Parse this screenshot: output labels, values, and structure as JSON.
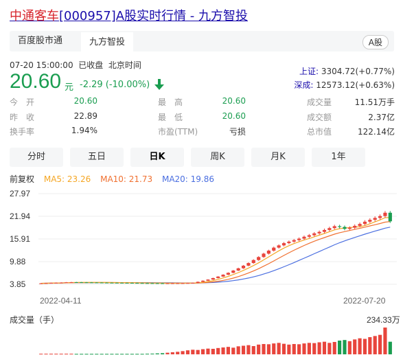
{
  "title": {
    "stock_name": "中通客车",
    "code_suffix": "[000957]A股实时行情 - 九方智投"
  },
  "tabs": [
    {
      "label": "百度股市通"
    },
    {
      "label": "九方智投"
    }
  ],
  "market_badge": "A股",
  "status": {
    "time": "07-20 15:00:00",
    "state": "已收盘",
    "zone": "北京时间"
  },
  "price": {
    "value": "20.60",
    "unit": "元",
    "change": "-2.29 (-10.00%)"
  },
  "indices": [
    {
      "name": "上证:",
      "value": "3304.72(+0.77%)"
    },
    {
      "name": "深成:",
      "value": "12573.12(+0.63%)"
    }
  ],
  "stats": [
    [
      {
        "label": "今　开",
        "value": "20.60",
        "green": true
      },
      {
        "label": "最　高",
        "value": "20.60",
        "green": true
      },
      {
        "label": "成交量",
        "value": "11.51万手"
      }
    ],
    [
      {
        "label": "昨　收",
        "value": "22.89"
      },
      {
        "label": "最　低",
        "value": "20.60",
        "green": true
      },
      {
        "label": "成交额",
        "value": "2.37亿"
      }
    ],
    [
      {
        "label": "换手率",
        "value": "1.94%"
      },
      {
        "label": "市盈(TTM)",
        "value": "亏损"
      },
      {
        "label": "总市值",
        "value": "122.14亿"
      }
    ]
  ],
  "periods": [
    {
      "label": "分时"
    },
    {
      "label": "五日"
    },
    {
      "label": "日K"
    },
    {
      "label": "周K"
    },
    {
      "label": "月K"
    },
    {
      "label": "1年"
    }
  ],
  "ma": {
    "adjust": "前复权",
    "ma5": "MA5: 23.26",
    "ma10": "MA10: 21.73",
    "ma20": "MA20: 19.86"
  },
  "colors": {
    "up": "#e8453c",
    "down": "#1a9d50",
    "ma5": "#f5a623",
    "ma10": "#f07030",
    "ma20": "#4a6ee0"
  },
  "chart_data": {
    "type": "candlestick",
    "y_ticks": [
      "27.97",
      "21.94",
      "15.91",
      "9.88",
      "3.85"
    ],
    "ylim": [
      3.85,
      27.97
    ],
    "x_labels": [
      "2022-04-11",
      "2022-07-20"
    ],
    "volume_label": "成交量（手）",
    "volume_max_label": "234.33万",
    "closes": [
      4.1,
      4.15,
      4.2,
      4.25,
      4.3,
      4.35,
      4.4,
      4.38,
      4.36,
      4.34,
      4.32,
      4.3,
      4.28,
      4.26,
      4.25,
      4.24,
      4.23,
      4.22,
      4.2,
      4.18,
      4.16,
      4.15,
      4.14,
      4.13,
      4.12,
      4.12,
      4.13,
      4.14,
      4.15,
      4.18,
      4.22,
      4.5,
      4.8,
      5.1,
      5.5,
      5.9,
      6.4,
      6.9,
      7.5,
      8.1,
      8.8,
      9.5,
      10.3,
      11.1,
      12.0,
      12.8,
      13.6,
      14.2,
      14.8,
      15.2,
      15.6,
      16.0,
      16.5,
      16.9,
      17.4,
      17.8,
      18.3,
      18.8,
      19.3,
      19.1,
      18.6,
      18.9,
      19.4,
      19.9,
      20.5,
      21.0,
      21.5,
      22.0,
      22.89,
      20.6
    ],
    "volumes": [
      0.05,
      0.05,
      0.05,
      0.05,
      0.05,
      0.05,
      0.05,
      0.04,
      0.04,
      0.04,
      0.04,
      0.04,
      0.04,
      0.04,
      0.04,
      0.04,
      0.04,
      0.04,
      0.04,
      0.04,
      0.04,
      0.05,
      0.06,
      0.08,
      0.1,
      0.14,
      0.18,
      0.22,
      0.28,
      0.35,
      0.4,
      0.38,
      0.45,
      0.5,
      0.48,
      0.55,
      0.6,
      0.65,
      0.58,
      0.7,
      0.75,
      0.8,
      0.72,
      0.85,
      0.9,
      0.88,
      0.95,
      1.0,
      0.92,
      0.85,
      0.9,
      0.88,
      0.95,
      1.0,
      0.98,
      1.05,
      1.1,
      1.0,
      1.08,
      1.2,
      1.25,
      1.15,
      1.3,
      1.4,
      1.35,
      1.5,
      1.6,
      1.7,
      2.34,
      1.1
    ]
  }
}
